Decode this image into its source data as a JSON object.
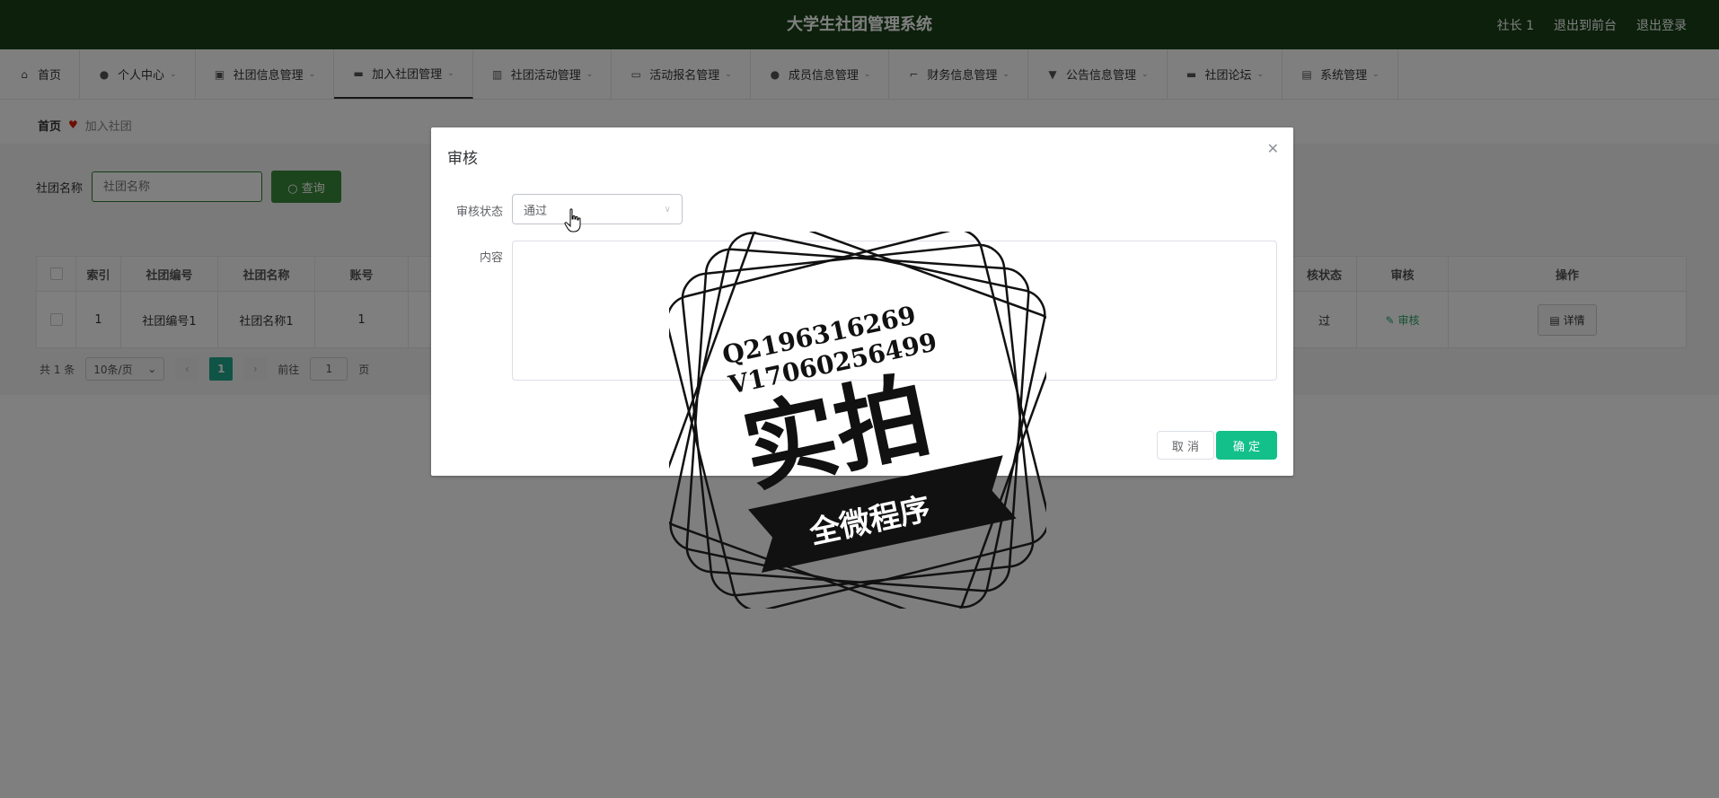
{
  "header": {
    "title": "大学生社团管理系统",
    "user": "社长 1",
    "to_frontend": "退出到前台",
    "logout": "退出登录"
  },
  "nav": {
    "items": [
      {
        "label": "首页",
        "icon": "home-icon"
      },
      {
        "label": "个人中心",
        "icon": "user-icon"
      },
      {
        "label": "社团信息管理",
        "icon": "card-icon"
      },
      {
        "label": "加入社团管理",
        "icon": "monitor-icon"
      },
      {
        "label": "社团活动管理",
        "icon": "chart-icon"
      },
      {
        "label": "活动报名管理",
        "icon": "card-icon"
      },
      {
        "label": "成员信息管理",
        "icon": "user-icon"
      },
      {
        "label": "财务信息管理",
        "icon": "crop-icon"
      },
      {
        "label": "公告信息管理",
        "icon": "notice-icon"
      },
      {
        "label": "社团论坛",
        "icon": "monitor-icon"
      },
      {
        "label": "系统管理",
        "icon": "clipboard-icon"
      }
    ]
  },
  "breadcrumb": {
    "home": "首页",
    "current": "加入社团"
  },
  "search": {
    "label": "社团名称",
    "placeholder": "社团名称",
    "button": "查询"
  },
  "table": {
    "headers": [
      "索引",
      "社团编号",
      "社团名称",
      "账号",
      "核状态",
      "审核",
      "操作"
    ],
    "row": {
      "index": "1",
      "club_no": "社团编号1",
      "club_name": "社团名称1",
      "account": "1",
      "status": "过",
      "audit": "审核",
      "detail": "详情"
    }
  },
  "pager": {
    "total": "共 1 条",
    "page_size": "10条/页",
    "current": "1",
    "goto_label": "前往",
    "goto_value": "1",
    "page_unit": "页"
  },
  "dialog": {
    "title": "审核",
    "status_label": "审核状态",
    "status_value": "通过",
    "content_label": "内容",
    "cancel": "取 消",
    "confirm": "确 定"
  },
  "watermark": {
    "line1": "Q2196316269",
    "line2": "V17060256499",
    "big": "实拍",
    "ribbon": "全微程序"
  },
  "colors": {
    "topbar": "#194019",
    "accent": "#13c08a",
    "search_button": "#3a8a3a"
  }
}
